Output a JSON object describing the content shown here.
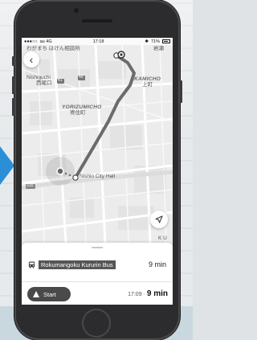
{
  "status_bar": {
    "carrier": "au 4G",
    "time": "17:18",
    "battery": "71%"
  },
  "map": {
    "labels": {
      "top_left": "わがまち ほけん相談所",
      "top_right": "岩瀬",
      "nishiguchi_en": "Nishiguchi",
      "nishiguchi_jp": "西尾口",
      "kamicho_en": "KAMICHO",
      "kamicho_jp": "上町",
      "yorizumicho_en": "YORIZUMICHO",
      "yorizumicho_jp": "寄住町",
      "route_41": "41",
      "route_48": "48",
      "route_316": "316",
      "city_hall": "Nishio City Hall",
      "bottom_right": "K U"
    },
    "colors": {
      "route": "#6b6b6b",
      "road": "#ffffff",
      "block": "#e8e8e8"
    }
  },
  "panel": {
    "route_name": "Rokumangoku Kururin Bus",
    "route_duration": "9 min",
    "start_label": "Start",
    "eta_time": "17:09 ·",
    "eta_duration": "9 min"
  },
  "icons": {
    "back": "chevron-left-icon",
    "locate": "navigation-arrow-icon",
    "bus": "bus-icon",
    "start": "navigation-start-icon"
  }
}
